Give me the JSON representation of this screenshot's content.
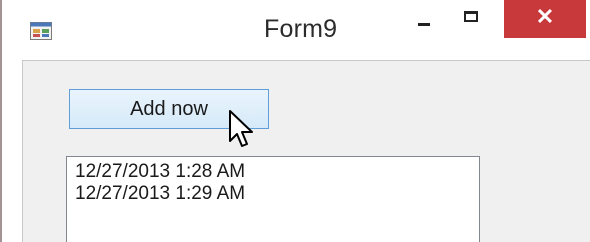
{
  "window": {
    "title": "Form9",
    "controls": {
      "minimize_icon": "minimize-icon",
      "maximize_icon": "maximize-icon",
      "close_glyph": "✕"
    },
    "close_color": "#c7393b"
  },
  "app_icon": "form-app-icon",
  "main": {
    "add_button_label": "Add now",
    "list_items": [
      "12/27/2013 1:28 AM",
      "12/27/2013 1:29 AM"
    ]
  },
  "cursor": "arrow-pointer"
}
